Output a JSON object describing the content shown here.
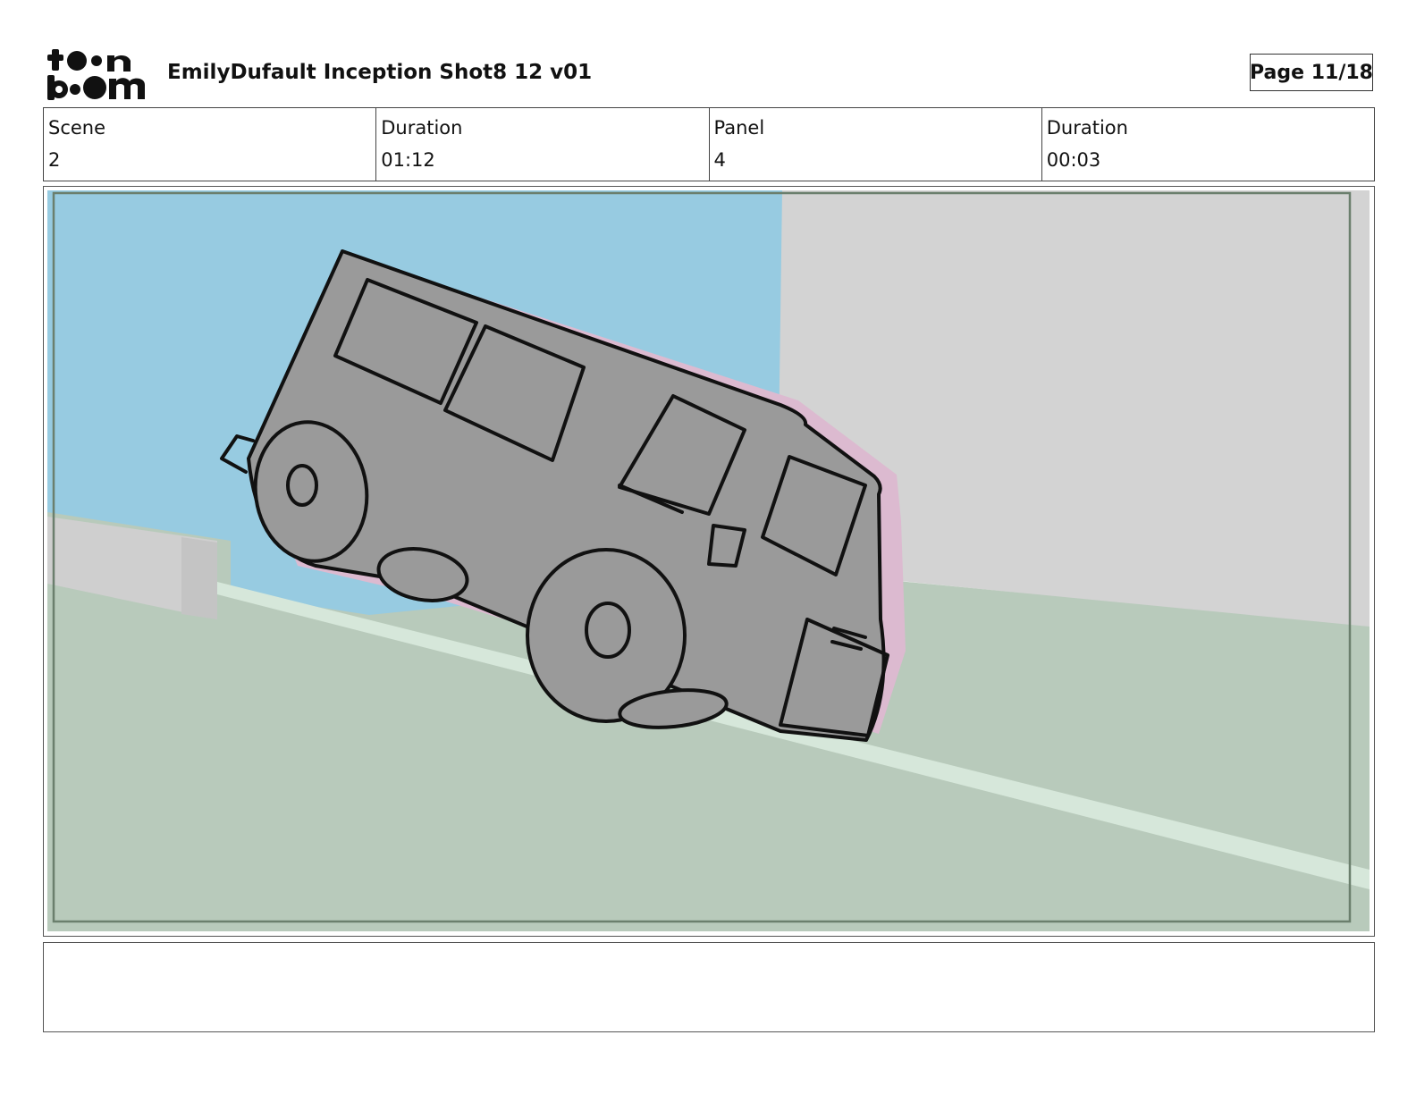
{
  "header": {
    "logo_icon": "toonboom-logo",
    "logo_text_line1": "toon",
    "logo_text_line2": "boom",
    "title": "EmilyDufault Inception Shot8 12 v01",
    "page": "Page 11/18"
  },
  "info": {
    "scene_label": "Scene",
    "scene_value": "2",
    "scene_duration_label": "Duration",
    "scene_duration_value": "01:12",
    "panel_label": "Panel",
    "panel_value": "4",
    "panel_duration_label": "Duration",
    "panel_duration_value": "00:03"
  },
  "panel": {
    "image_icon": "storyboard-panel-van-icon",
    "colors": {
      "sky": "#97cbe1",
      "wall": "#d3d3d3",
      "ground": "#b8cabb",
      "road_line": "#d6e7da",
      "vehicle": "#9a9a9a",
      "shadow": "#dcbad0",
      "ink": "#111111"
    }
  },
  "notes": {
    "text": ""
  }
}
